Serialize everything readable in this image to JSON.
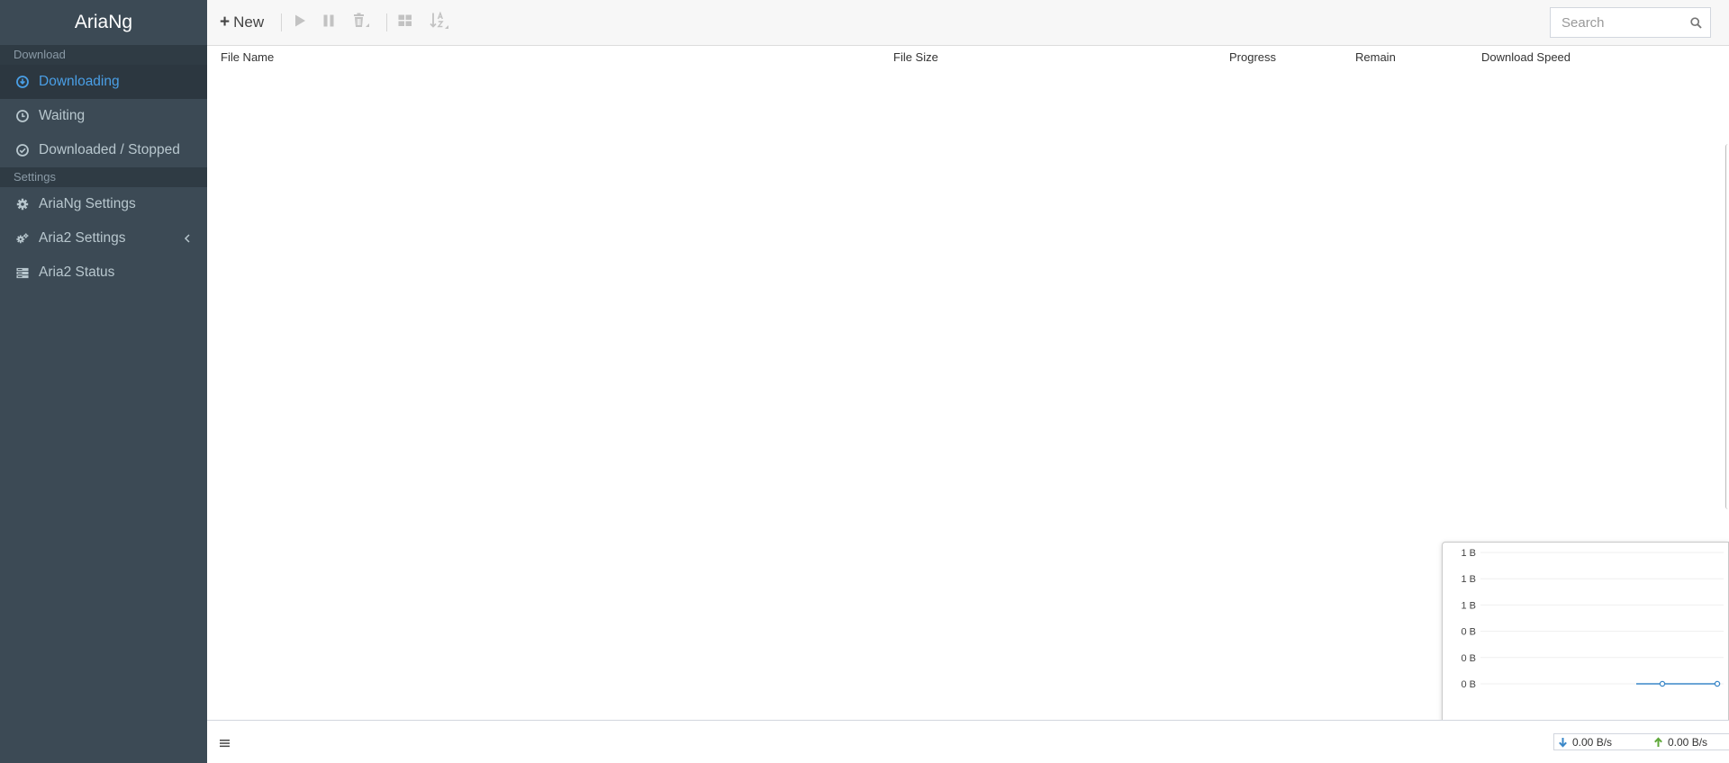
{
  "app": {
    "brand": "AriaNg"
  },
  "sidebar": {
    "sections": [
      {
        "label": "Download"
      },
      {
        "label": "Settings"
      }
    ],
    "items": [
      {
        "label": "Downloading",
        "icon": "arrow-circle-down-icon"
      },
      {
        "label": "Waiting",
        "icon": "clock-icon"
      },
      {
        "label": "Downloaded / Stopped",
        "icon": "check-circle-icon"
      },
      {
        "label": "AriaNg Settings",
        "icon": "gear-icon"
      },
      {
        "label": "Aria2 Settings",
        "icon": "gears-icon"
      },
      {
        "label": "Aria2 Status",
        "icon": "server-icon"
      }
    ]
  },
  "toolbar": {
    "new_label": "New",
    "search_placeholder": "Search"
  },
  "table": {
    "columns": [
      "File Name",
      "File Size",
      "Progress",
      "Remain",
      "Download Speed"
    ]
  },
  "chart_data": {
    "type": "line",
    "title": "",
    "y_tick_labels": [
      "1 B",
      "1 B",
      "1 B",
      "0 B",
      "0 B",
      "0 B"
    ],
    "series": [
      {
        "values": [
          0,
          0,
          0
        ],
        "color": "#3a87c8"
      }
    ]
  },
  "footer": {
    "download_speed": "0.00 B/s",
    "upload_speed": "0.00 B/s"
  },
  "colors": {
    "sidebar_bg": "#3c4a55",
    "active_text": "#4a9fe6",
    "download_arrow": "#3a87c8",
    "upload_arrow": "#5fa83a"
  }
}
